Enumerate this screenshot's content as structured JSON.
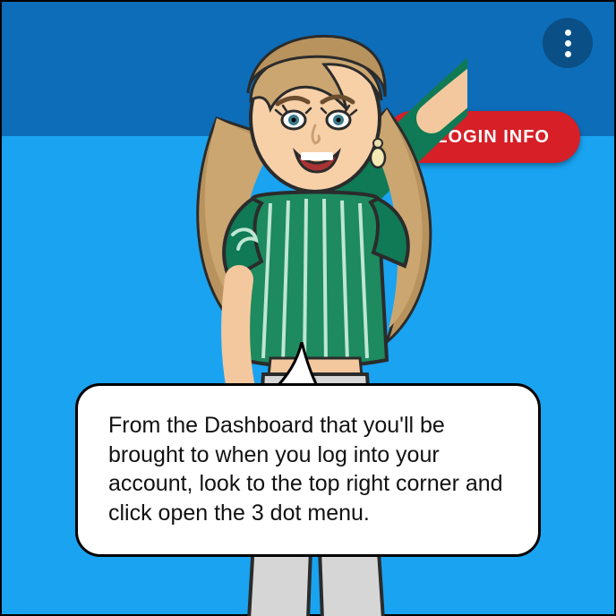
{
  "colors": {
    "topbar": "#0d6db8",
    "background": "#1aa3f0",
    "kebab_bg": "#0a4f85",
    "login_bg": "#d61f26"
  },
  "topbar": {
    "kebab_label": "3 dot menu"
  },
  "login_button": {
    "label": "D LOGIN INFO"
  },
  "speech": {
    "text": "From the Dashboard that you'll be brought to when you log into your account, look to the top right corner and click open the 3 dot menu."
  }
}
